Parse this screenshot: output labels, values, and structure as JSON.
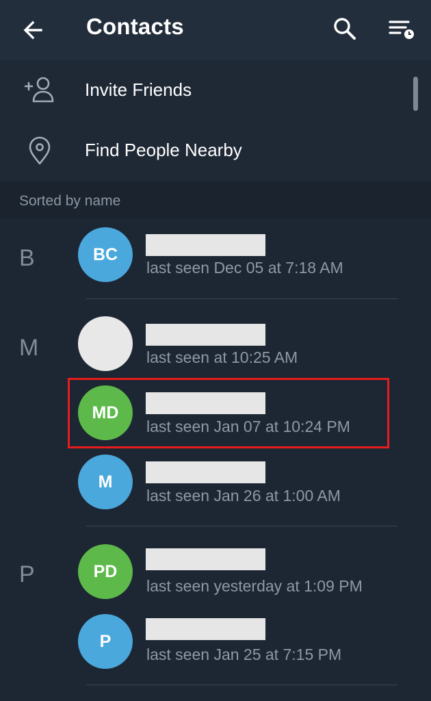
{
  "header": {
    "title": "Contacts",
    "back_icon": "arrow-left-icon",
    "search_icon": "search-icon",
    "sort_icon": "sort-by-time-icon"
  },
  "actions": [
    {
      "label": "Invite Friends",
      "icon": "add-person-icon"
    },
    {
      "label": "Find People Nearby",
      "icon": "location-pin-icon"
    }
  ],
  "section_header": "Sorted by name",
  "letters": [
    "B",
    "M",
    "P"
  ],
  "contacts": [
    {
      "initials": "BC",
      "status": "last seen Dec 05 at 7:18 AM",
      "avatar_color": "#4aa8dd"
    },
    {
      "initials": "",
      "status": "last seen at 10:25 AM",
      "avatar_color": "#e8e8e8"
    },
    {
      "initials": "MD",
      "status": "last seen Jan 07 at 10:24 PM",
      "avatar_color": "#5dba4a"
    },
    {
      "initials": "M",
      "status": "last seen Jan 26 at 1:00 AM",
      "avatar_color": "#4aa8dd"
    },
    {
      "initials": "PD",
      "status": "last seen yesterday at 1:09 PM",
      "avatar_color": "#5dba4a"
    },
    {
      "initials": "P",
      "status": "last seen Jan 25 at 7:15 PM",
      "avatar_color": "#4aa8dd"
    }
  ],
  "colors": {
    "background": "#1d2733",
    "appbar": "#232e3c",
    "highlight": "#e81c1c"
  }
}
